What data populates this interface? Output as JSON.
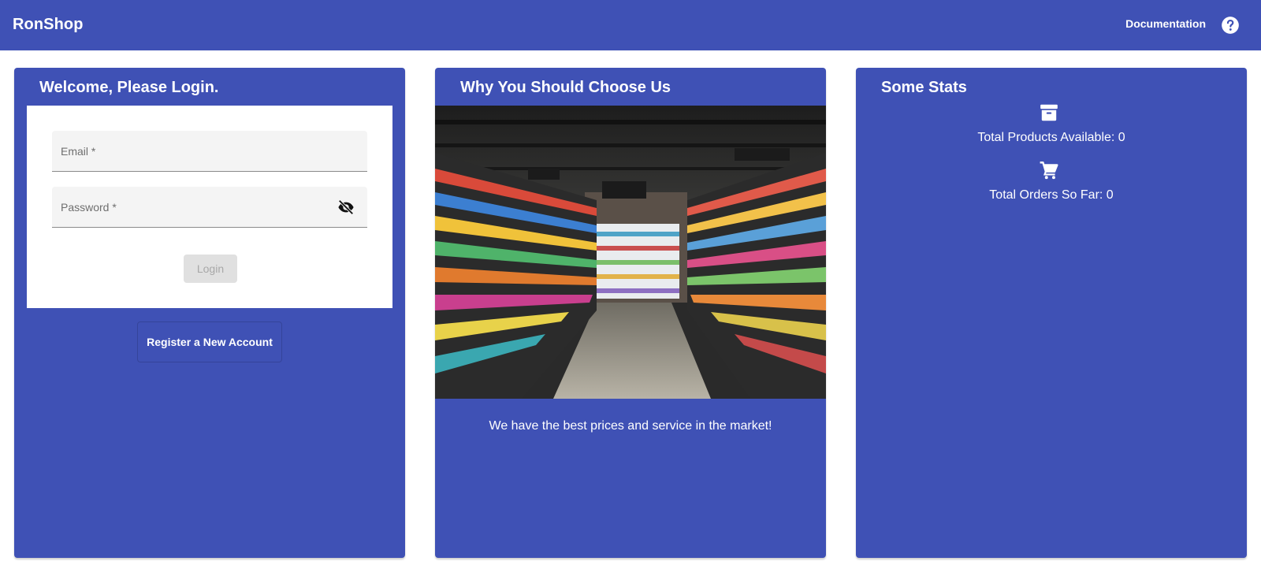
{
  "app": {
    "brand": "RonShop",
    "documentation_label": "Documentation",
    "help_icon": "help-circle-icon"
  },
  "login_card": {
    "title": "Welcome, Please Login.",
    "email_label": "Email *",
    "password_label": "Password *",
    "password_visibility_icon": "eye-off-icon",
    "login_label": "Login",
    "register_label": "Register a New Account"
  },
  "why_card": {
    "title": "Why You Should Choose Us",
    "tagline": "We have the best prices and service in the market!"
  },
  "stats_card": {
    "title": "Some Stats",
    "products_icon": "archive-icon",
    "products_text": "Total Products Available: 0",
    "orders_icon": "shopping-cart-icon",
    "orders_text": "Total Orders So Far: 0"
  },
  "colors": {
    "primary": "#3f51b5",
    "surface": "#ffffff",
    "disabled_button": "#e0e0e0"
  }
}
